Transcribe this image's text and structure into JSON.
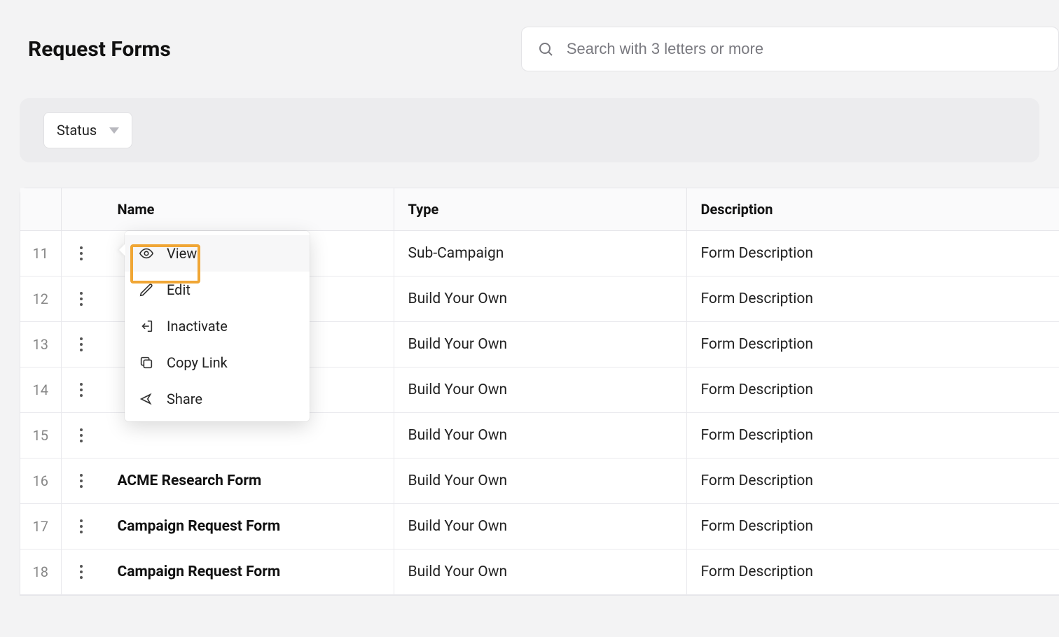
{
  "page": {
    "title": "Request Forms"
  },
  "search": {
    "placeholder": "Search with 3 letters or more"
  },
  "filters": {
    "status_label": "Status"
  },
  "table": {
    "columns": {
      "name": "Name",
      "type": "Type",
      "description": "Description"
    },
    "rows": [
      {
        "num": "11",
        "name": "",
        "type": "Sub-Campaign",
        "description": "Form Description"
      },
      {
        "num": "12",
        "name": "",
        "type": "Build Your Own",
        "description": "Form Description"
      },
      {
        "num": "13",
        "name": "",
        "type": "Build Your Own",
        "description": "Form Description"
      },
      {
        "num": "14",
        "name": "",
        "type": "Build Your Own",
        "description": "Form Description"
      },
      {
        "num": "15",
        "name": "",
        "type": "Build Your Own",
        "description": "Form Description"
      },
      {
        "num": "16",
        "name": "ACME Research Form",
        "type": "Build Your Own",
        "description": "Form Description"
      },
      {
        "num": "17",
        "name": "Campaign Request Form",
        "type": "Build Your Own",
        "description": "Form Description"
      },
      {
        "num": "18",
        "name": "Campaign Request Form",
        "type": "Build Your Own",
        "description": "Form Description"
      }
    ]
  },
  "context_menu": {
    "view": "View",
    "edit": "Edit",
    "inactivate": "Inactivate",
    "copy_link": "Copy Link",
    "share": "Share"
  }
}
